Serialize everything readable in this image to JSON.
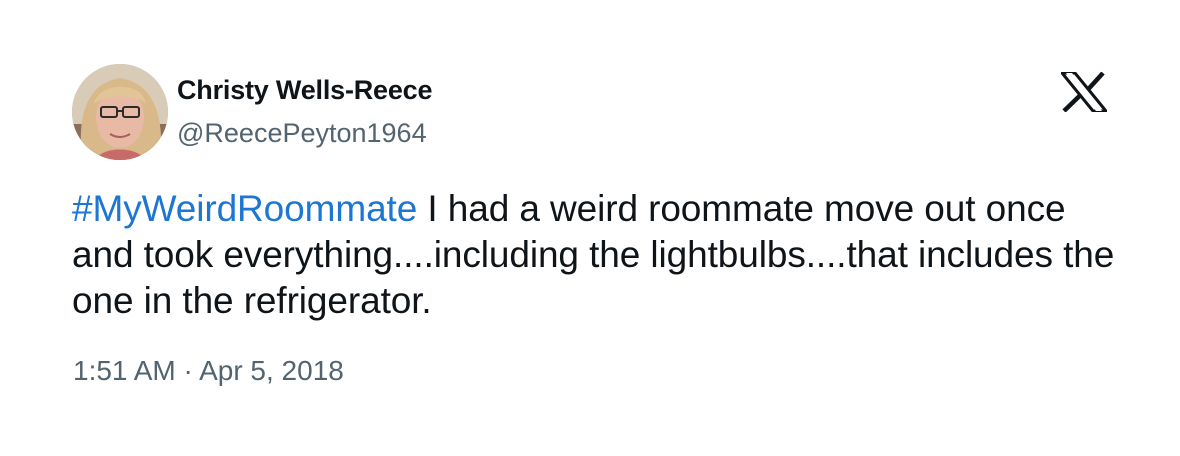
{
  "tweet": {
    "author": {
      "display_name": "Christy Wells-Reece",
      "handle": "@ReecePeyton1964",
      "avatar": "profile-photo"
    },
    "platform_icon": "x-logo-icon",
    "text": {
      "hashtag": "#MyWeirdRoommate",
      "body": " I had a weird roommate move out once and took everything....including the lightbulbs....that includes the one in the refrigerator."
    },
    "time": "1:51 AM",
    "separator": "·",
    "date": "Apr 5, 2018"
  },
  "colors": {
    "hashtag": "#1d76d2",
    "secondary_text": "#536471",
    "primary_text": "#0f1419",
    "background": "#ffffff"
  }
}
